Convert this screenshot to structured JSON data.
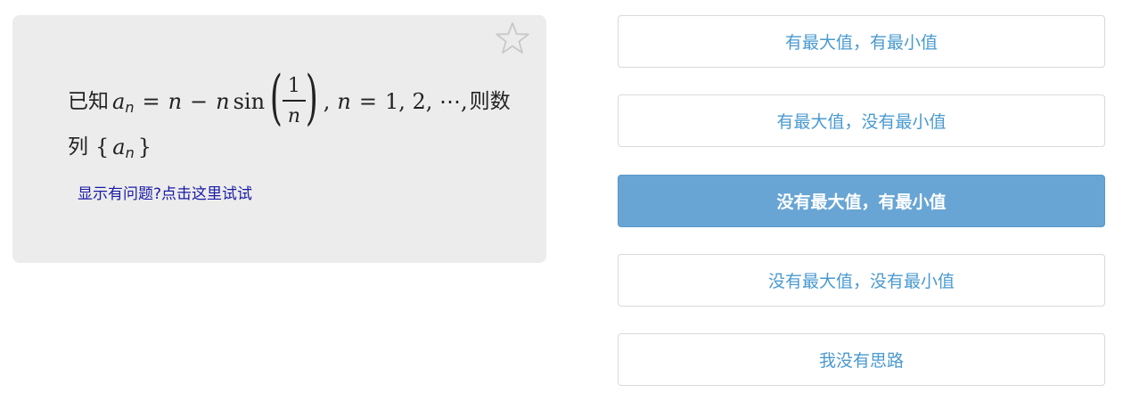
{
  "question": {
    "prefix": "已知",
    "var_a": "a",
    "sub_n": "n",
    "equals": "=",
    "n1": "n",
    "minus": "−",
    "n2": "n",
    "sin": "sin",
    "frac_num": "1",
    "frac_den": "n",
    "comma1": ",",
    "n3": "n",
    "equals2": "=",
    "seq": "1, 2, ⋯,",
    "suffix_line1": "则数",
    "line2_prefix": "列",
    "brace_open": "{",
    "var_a2": "a",
    "sub_n2": "n",
    "brace_close": "}",
    "help_link": "显示有问题?点击这里试试",
    "star_icon": "star-outline"
  },
  "options": [
    {
      "label": "有最大值，有最小值",
      "selected": false
    },
    {
      "label": "有最大值，没有最小值",
      "selected": false
    },
    {
      "label": "没有最大值，有最小值",
      "selected": true
    },
    {
      "label": "没有最大值，没有最小值",
      "selected": false
    },
    {
      "label": "我没有思路",
      "selected": false
    }
  ],
  "colors": {
    "card_bg": "#ececec",
    "option_text": "#4a9ad0",
    "selected_bg": "#68a5d4",
    "link": "#1a1aa6"
  }
}
